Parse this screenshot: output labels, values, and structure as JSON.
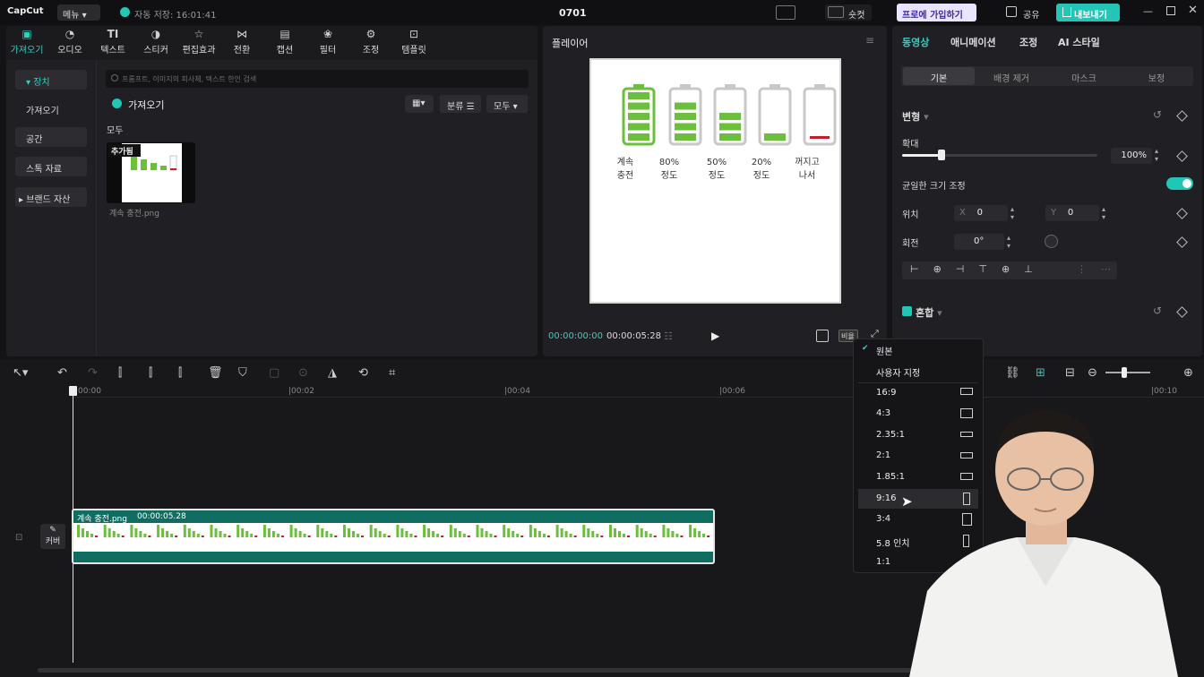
{
  "topbar": {
    "logo": "CapCut",
    "menu": "메뉴",
    "autosave": "자동 저장: 16:01:41",
    "project_title": "0701",
    "shortcut": "숏컷",
    "pro": "프로에 가입하기",
    "share": "공유",
    "export": "내보내기"
  },
  "media_tabs": [
    {
      "label": "가져오기",
      "icon": "import-icon"
    },
    {
      "label": "오디오",
      "icon": "audio-icon"
    },
    {
      "label": "텍스트",
      "icon": "text-icon"
    },
    {
      "label": "스티커",
      "icon": "sticker-icon"
    },
    {
      "label": "편집효과",
      "icon": "effects-icon"
    },
    {
      "label": "전환",
      "icon": "transition-icon"
    },
    {
      "label": "캡션",
      "icon": "caption-icon"
    },
    {
      "label": "필터",
      "icon": "filter-icon"
    },
    {
      "label": "조정",
      "icon": "adjust-icon"
    },
    {
      "label": "템플릿",
      "icon": "template-icon"
    }
  ],
  "sidebar": {
    "items": [
      "장치",
      "가져오기",
      "공간",
      "스톡 자료",
      "브랜드 자산"
    ]
  },
  "media": {
    "search_placeholder": "프롬프트, 이미지의 피사체, 텍스트 한인 검색",
    "import_button": "가져오기",
    "sort_button": "분류",
    "all_button": "모두",
    "section": "모두",
    "added_badge": "추가됨",
    "file_name": "계속 충전.png"
  },
  "player": {
    "title": "플레이어",
    "current_time": "00:00:00:00",
    "total_time": "00:00:05:28",
    "ratio_button": "비율",
    "batteries": [
      {
        "line1": "계속",
        "line2": "충전",
        "level": 1.0
      },
      {
        "line1": "80%",
        "line2": "정도",
        "level": 0.8
      },
      {
        "line1": "50%",
        "line2": "정도",
        "level": 0.5
      },
      {
        "line1": "20%",
        "line2": "정도",
        "level": 0.2
      },
      {
        "line1": "꺼지고",
        "line2": "나서",
        "level": 0.05
      }
    ],
    "battery_green": "#6cbf3d",
    "battery_red": "#c0202a"
  },
  "right_panel": {
    "tabs": [
      "동영상",
      "애니메이션",
      "조정",
      "AI 스타일"
    ],
    "sub_tabs": [
      "기본",
      "배경 제거",
      "마스크",
      "보정"
    ],
    "transform": "변형",
    "scale_label": "확대",
    "scale_value": "100%",
    "scale_level": 0.2,
    "uniform_scale": "균일한 크기 조정",
    "position_label": "위치",
    "x_label": "X",
    "x_value": "0",
    "y_label": "Y",
    "y_value": "0",
    "rotate_label": "회전",
    "rotate_value": "0°",
    "blend": "혼합"
  },
  "aspect_menu": {
    "items": [
      "원본",
      "사용자 지정",
      "16:9",
      "4:3",
      "2.35:1",
      "2:1",
      "1.85:1",
      "9:16",
      "3:4",
      "5.8 인치",
      "1:1"
    ],
    "selected": "원본",
    "hovered": "9:16"
  },
  "timeline": {
    "ticks": [
      "00:00",
      "00:02",
      "00:04",
      "00:06",
      "00:10"
    ],
    "clip_name": "계속 충전.png",
    "clip_duration": "00:00:05.28",
    "cover_label": "커버"
  },
  "colors": {
    "accent": "#21c6b7",
    "clip": "#0f6e61"
  }
}
